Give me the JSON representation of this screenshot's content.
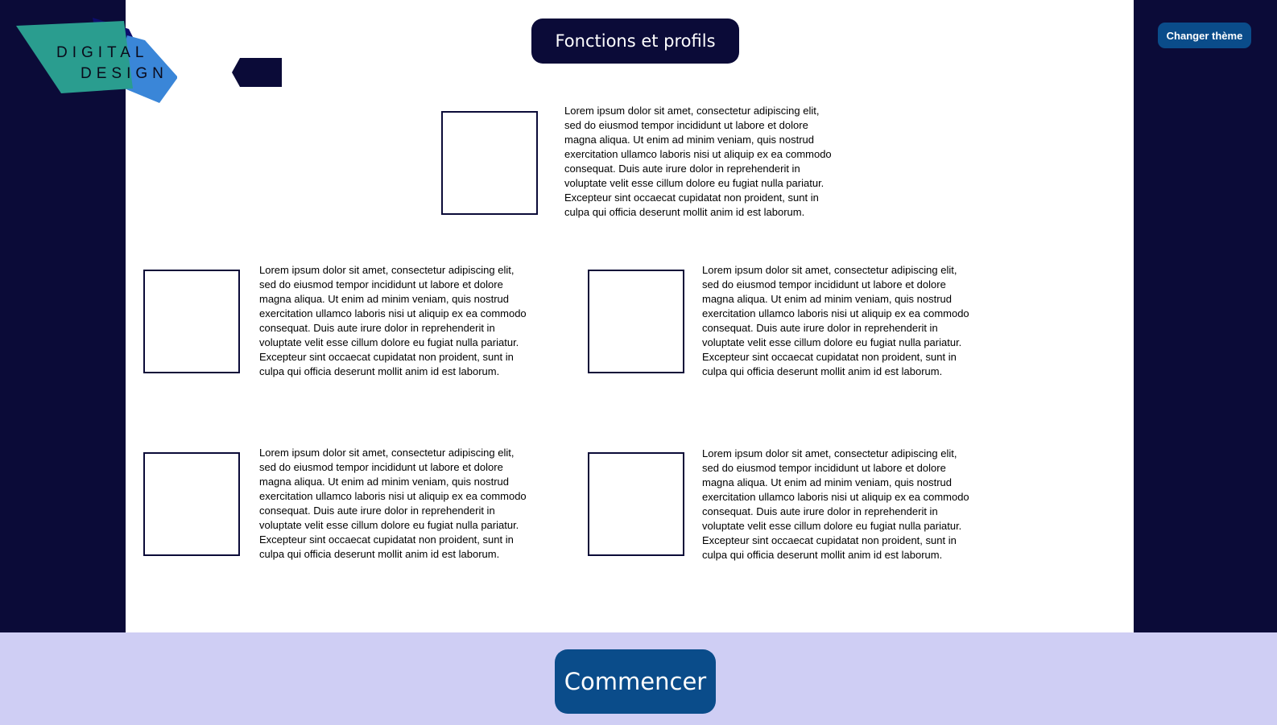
{
  "logo": {
    "line1": "DIGITAL",
    "line2": "DESIGN"
  },
  "header": {
    "title": "Fonctions et profils",
    "theme_button_label": "Changer thème"
  },
  "cards": [
    {
      "text": "Lorem ipsum dolor sit amet, consectetur adipiscing elit, sed do eiusmod tempor incididunt ut labore et dolore magna aliqua. Ut enim ad minim veniam, quis nostrud exercitation ullamco laboris nisi ut aliquip ex ea commodo consequat. Duis aute irure dolor in reprehenderit in voluptate velit esse cillum dolore eu fugiat nulla pariatur. Excepteur sint occaecat cupidatat non proident, sunt in culpa qui officia deserunt mollit anim id est laborum."
    },
    {
      "text": "Lorem ipsum dolor sit amet, consectetur adipiscing elit, sed do eiusmod tempor incididunt ut labore et dolore magna aliqua. Ut enim ad minim veniam, quis nostrud exercitation ullamco laboris nisi ut aliquip ex ea commodo consequat. Duis aute irure dolor in reprehenderit in voluptate velit esse cillum dolore eu fugiat nulla pariatur. Excepteur sint occaecat cupidatat non proident, sunt in culpa qui officia deserunt mollit anim id est laborum."
    },
    {
      "text": "Lorem ipsum dolor sit amet, consectetur adipiscing elit, sed do eiusmod tempor incididunt ut labore et dolore magna aliqua. Ut enim ad minim veniam, quis nostrud exercitation ullamco laboris nisi ut aliquip ex ea commodo consequat. Duis aute irure dolor in reprehenderit in voluptate velit esse cillum dolore eu fugiat nulla pariatur. Excepteur sint occaecat cupidatat non proident, sunt in culpa qui officia deserunt mollit anim id est laborum."
    },
    {
      "text": "Lorem ipsum dolor sit amet, consectetur adipiscing elit, sed do eiusmod tempor incididunt ut labore et dolore magna aliqua. Ut enim ad minim veniam, quis nostrud exercitation ullamco laboris nisi ut aliquip ex ea commodo consequat. Duis aute irure dolor in reprehenderit in voluptate velit esse cillum dolore eu fugiat nulla pariatur. Excepteur sint occaecat cupidatat non proident, sunt in culpa qui officia deserunt mollit anim id est laborum."
    },
    {
      "text": "Lorem ipsum dolor sit amet, consectetur adipiscing elit, sed do eiusmod tempor incididunt ut labore et dolore magna aliqua. Ut enim ad minim veniam, quis nostrud exercitation ullamco laboris nisi ut aliquip ex ea commodo consequat. Duis aute irure dolor in reprehenderit in voluptate velit esse cillum dolore eu fugiat nulla pariatur. Excepteur sint occaecat cupidatat non proident, sunt in culpa qui officia deserunt mollit anim id est laborum."
    }
  ],
  "footer": {
    "start_label": "Commencer"
  },
  "colors": {
    "side_background": "#0b0b38",
    "panel_background": "#ffffff",
    "footer_background": "#cfcef4",
    "button_blue": "#0a4c8a",
    "logo_teal": "#2a9d8f",
    "logo_blue": "#3a86d8",
    "logo_navy": "#0d0d6b"
  }
}
